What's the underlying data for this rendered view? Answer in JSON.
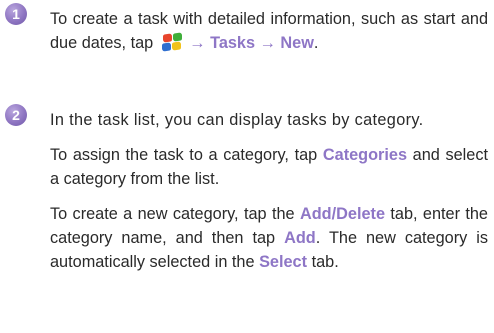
{
  "steps": [
    {
      "number": "1",
      "paragraphs": [
        {
          "text_1": "To create a task with detailed information, such as start and due dates, tap ",
          "icon": "windows-start-icon",
          "arrow_1": " → ",
          "kw_1": "Tasks",
          "arrow_2": " → ",
          "kw_2": "New",
          "end": "."
        }
      ]
    },
    {
      "number": "2",
      "paragraphs": [
        {
          "text": "In the task list, you can display tasks by category."
        },
        {
          "text_1": "To assign the task to a category, tap ",
          "kw_1": "Categories",
          "text_2": " and select a category from the list."
        },
        {
          "text_1": "To create a new category, tap the ",
          "kw_1": "Add/Delete",
          "text_2": " tab, enter the category name, and then tap ",
          "kw_2": "Add",
          "text_3": ". The new category is automatically selected in the ",
          "kw_3": "Select",
          "text_4": " tab."
        }
      ]
    }
  ],
  "colors": {
    "keyword": "#8e76c6",
    "badge": "#8f76c2",
    "text": "#2a2a2a"
  }
}
